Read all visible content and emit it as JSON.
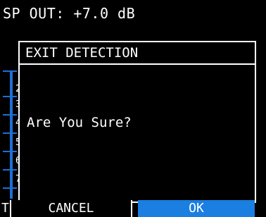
{
  "status": {
    "sp_out": "SP OUT: +7.0 dB"
  },
  "background_list": {
    "numbers": [
      "2",
      "3",
      "4",
      "5",
      "6",
      "7"
    ],
    "side_letter": "T"
  },
  "dialog": {
    "title": "EXIT DETECTION",
    "message": "Are You Sure?",
    "cancel_label": "CANCEL",
    "ok_label": "OK"
  },
  "colors": {
    "background": "#000000",
    "text": "#ffffff",
    "accent_blue": "#1a7fe0"
  }
}
